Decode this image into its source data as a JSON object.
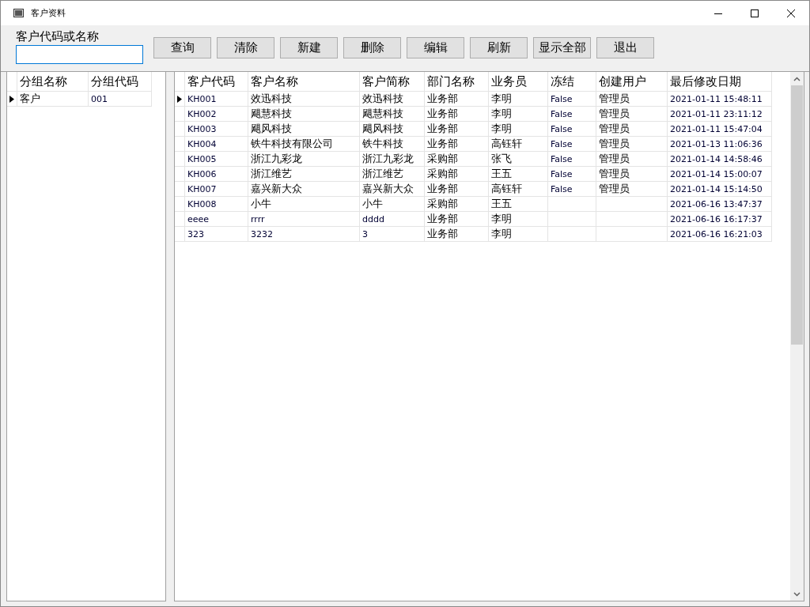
{
  "window": {
    "title": "客户资料"
  },
  "search": {
    "label": "客户代码或名称"
  },
  "buttons": [
    "查询",
    "清除",
    "新建",
    "删除",
    "编辑",
    "刷新",
    "显示全部",
    "退出"
  ],
  "groups": {
    "columns": [
      "分组名称",
      "分组代码"
    ],
    "rows": [
      {
        "cells": [
          "客户",
          "001"
        ],
        "selected": true
      }
    ]
  },
  "customers": {
    "columns": [
      "客户代码",
      "客户名称",
      "客户简称",
      "部门名称",
      "业务员",
      "冻结",
      "创建用户",
      "最后修改日期"
    ],
    "rows": [
      {
        "cells": [
          "KH001",
          "效迅科技",
          "效迅科技",
          "业务部",
          "李明",
          "False",
          "管理员",
          "2021-01-11 15:48:11"
        ],
        "selected": true
      },
      {
        "cells": [
          "KH002",
          "飓慧科技",
          "飓慧科技",
          "业务部",
          "李明",
          "False",
          "管理员",
          "2021-01-11 23:11:12"
        ],
        "selected": false
      },
      {
        "cells": [
          "KH003",
          "飓风科技",
          "飓风科技",
          "业务部",
          "李明",
          "False",
          "管理员",
          "2021-01-11 15:47:04"
        ],
        "selected": false
      },
      {
        "cells": [
          "KH004",
          "铁牛科技有限公司",
          "铁牛科技",
          "业务部",
          "高钰轩",
          "False",
          "管理员",
          "2021-01-13 11:06:36"
        ],
        "selected": false
      },
      {
        "cells": [
          "KH005",
          "浙江九彩龙",
          "浙江九彩龙",
          "采购部",
          "张飞",
          "False",
          "管理员",
          "2021-01-14 14:58:46"
        ],
        "selected": false
      },
      {
        "cells": [
          "KH006",
          "浙江维艺",
          "浙江维艺",
          "采购部",
          "王五",
          "False",
          "管理员",
          "2021-01-14 15:00:07"
        ],
        "selected": false
      },
      {
        "cells": [
          "KH007",
          "嘉兴新大众",
          "嘉兴新大众",
          "业务部",
          "高钰轩",
          "False",
          "管理员",
          "2021-01-14 15:14:50"
        ],
        "selected": false
      },
      {
        "cells": [
          "KH008",
          "小牛",
          "小牛",
          "采购部",
          "王五",
          "",
          "",
          "2021-06-16 13:47:37"
        ],
        "selected": false
      },
      {
        "cells": [
          "eeee",
          "rrrr",
          "dddd",
          "业务部",
          "李明",
          "",
          "",
          "2021-06-16 16:17:37"
        ],
        "selected": false
      },
      {
        "cells": [
          "323",
          "3232",
          "3",
          "业务部",
          "李明",
          "",
          "",
          "2021-06-16 16:21:03"
        ],
        "selected": false
      }
    ]
  }
}
